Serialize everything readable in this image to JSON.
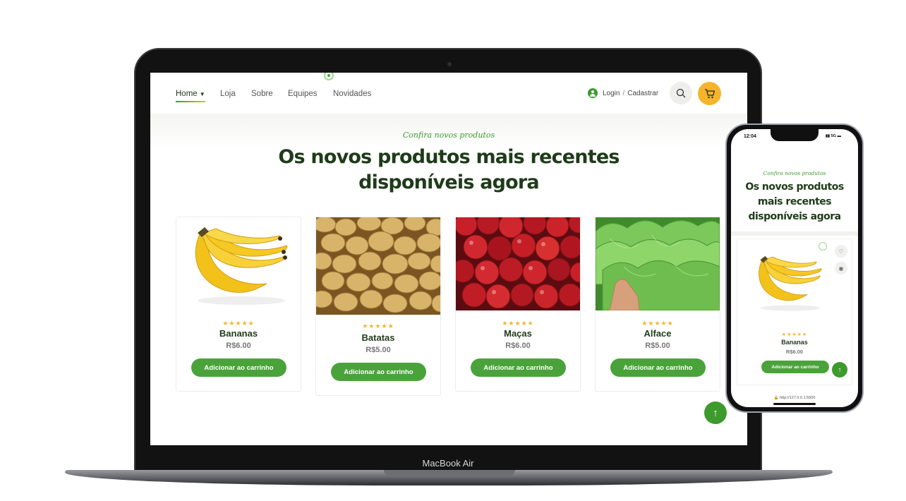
{
  "nav": {
    "items": [
      {
        "label": "Home",
        "active": true
      },
      {
        "label": "Loja"
      },
      {
        "label": "Sobre"
      },
      {
        "label": "Equipes"
      },
      {
        "label": "Novidades"
      }
    ],
    "login": "Login",
    "separator": "/",
    "signup": "Cadastrar",
    "icons": [
      "user-icon",
      "search-icon",
      "cart-icon"
    ],
    "accent_color": "#3d9a2c",
    "cart_color": "#f6b42c"
  },
  "section": {
    "subtitle": "Confira novos produtos",
    "title_line1": "Os novos produtos mais recentes",
    "title_line2": "disponíveis agora"
  },
  "products": [
    {
      "name": "Bananas",
      "price": "R$6.00",
      "rating": "★★★★★",
      "button": "Adicionar ao carrinho"
    },
    {
      "name": "Batatas",
      "price": "R$5.00",
      "rating": "★★★★★",
      "button": "Adicionar ao carrinho"
    },
    {
      "name": "Maças",
      "price": "R$6.00",
      "rating": "★★★★★",
      "button": "Adicionar ao carrinho"
    },
    {
      "name": "Alface",
      "price": "R$5.00",
      "rating": "★★★★★",
      "button": "Adicionar ao carrinho"
    }
  ],
  "scroll_top": "↑",
  "laptop": {
    "label": "MacBook Air"
  },
  "phone": {
    "time": "12:04",
    "status": "5G",
    "subtitle": "Confira novos produtos",
    "title_line1": "Os novos produtos",
    "title_line2": "mais recentes",
    "title_line3": "disponíveis agora",
    "product": {
      "name": "Bananas",
      "price": "R$6.00",
      "rating": "★★★★★",
      "button": "Adicionar ao carrinho"
    },
    "url": "http://127.0.0.1:5500",
    "scroll_top": "↑"
  }
}
